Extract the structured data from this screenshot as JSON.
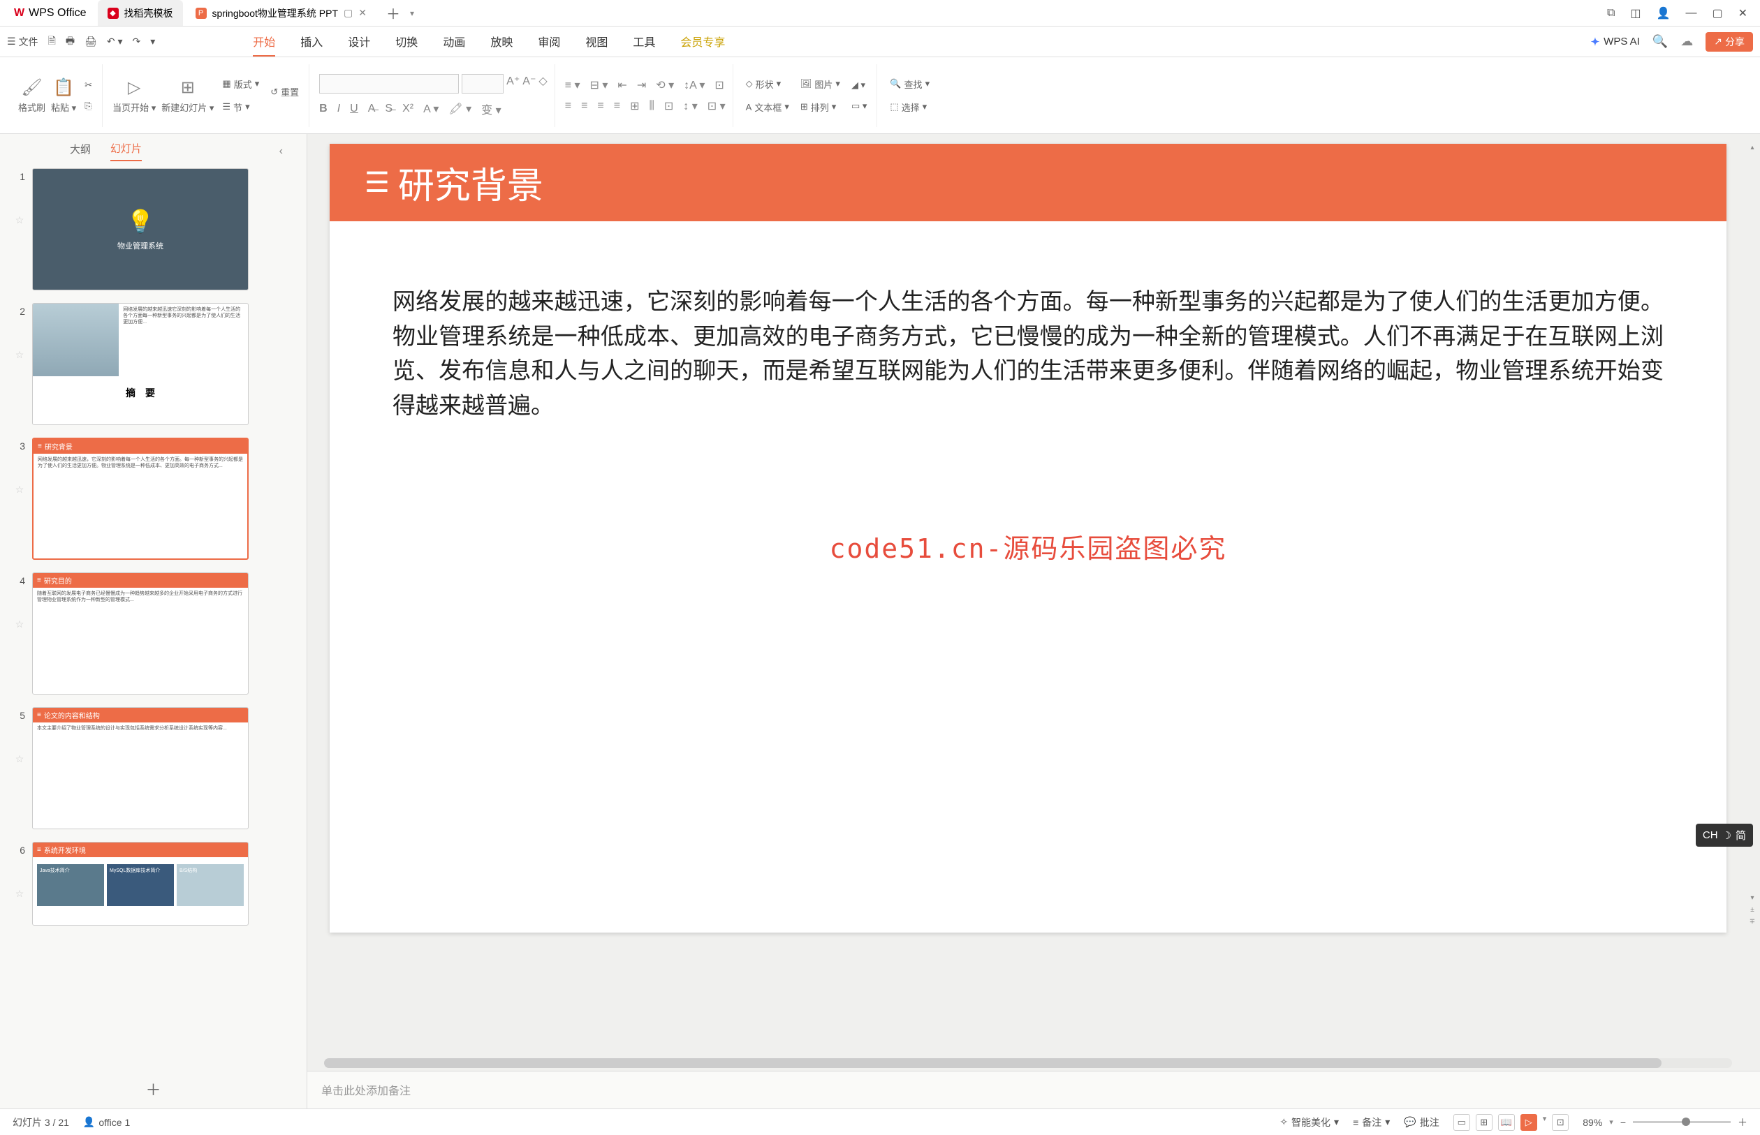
{
  "titlebar": {
    "app_name": "WPS Office",
    "tabs": [
      {
        "label": "找稻壳模板",
        "icon_bg": "red"
      },
      {
        "label": "springboot物业管理系统 PPT",
        "icon_bg": "orange",
        "active": true
      }
    ]
  },
  "menubar": {
    "file_label": "文件",
    "tabs": [
      "开始",
      "插入",
      "设计",
      "切换",
      "动画",
      "放映",
      "审阅",
      "视图",
      "工具",
      "会员专享"
    ],
    "active_tab": "开始",
    "vip_tab": "会员专享",
    "wps_ai": "WPS AI",
    "share": "分享"
  },
  "ribbon": {
    "format_painter": "格式刷",
    "paste": "粘贴",
    "from_page": "当页开始",
    "new_slide": "新建幻灯片",
    "layout": "版式",
    "reset": "重置",
    "section": "节",
    "shape": "形状",
    "image": "图片",
    "textbox": "文本框",
    "arrange": "排列",
    "find": "查找",
    "select": "选择"
  },
  "panel": {
    "outline_tab": "大纲",
    "slides_tab": "幻灯片",
    "slides": [
      {
        "num": "1",
        "title": "物业管理系统"
      },
      {
        "num": "2",
        "title": "摘　要"
      },
      {
        "num": "3",
        "title": "研究背景"
      },
      {
        "num": "4",
        "title": "研究目的"
      },
      {
        "num": "5",
        "title": "论文的内容和结构"
      },
      {
        "num": "6",
        "title": "系统开发环境"
      }
    ],
    "selected": 3
  },
  "slide": {
    "header_title": "研究背景",
    "body": "网络发展的越来越迅速，它深刻的影响着每一个人生活的各个方面。每一种新型事务的兴起都是为了使人们的生活更加方便。物业管理系统是一种低成本、更加高效的电子商务方式，它已慢慢的成为一种全新的管理模式。人们不再满足于在互联网上浏览、发布信息和人与人之间的聊天，而是希望互联网能为人们的生活带来更多便利。伴随着网络的崛起，物业管理系统开始变得越来越普遍。",
    "watermark": "code51.cn-源码乐园盗图必究",
    "notes_placeholder": "单击此处添加备注"
  },
  "statusbar": {
    "slide_indicator": "幻灯片 3 / 21",
    "author": "office 1",
    "smart_beautify": "智能美化",
    "notes": "备注",
    "comments": "批注",
    "zoom": "89%"
  },
  "ime": {
    "label": "CH",
    "mode": "简"
  }
}
